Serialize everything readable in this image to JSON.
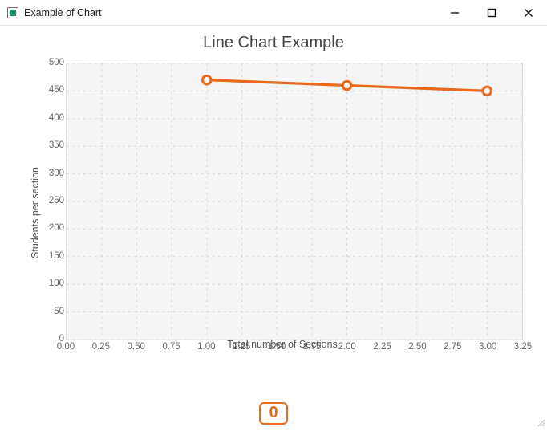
{
  "window": {
    "title": "Example of Chart",
    "min_label": "Minimize",
    "max_label": "Maximize",
    "close_label": "Close"
  },
  "chart_data": {
    "type": "line",
    "title": "Line Chart Example",
    "xlabel": "Total number of Sections",
    "ylabel": "Students per section",
    "x": [
      1.0,
      2.0,
      3.0
    ],
    "values": [
      470,
      460,
      450
    ],
    "xlim": [
      0.0,
      3.25
    ],
    "ylim": [
      0,
      500
    ],
    "x_ticks": [
      0.0,
      0.25,
      0.5,
      0.75,
      1.0,
      1.25,
      1.5,
      1.75,
      2.0,
      2.25,
      2.5,
      2.75,
      3.0,
      3.25
    ],
    "y_ticks": [
      0,
      50,
      100,
      150,
      200,
      250,
      300,
      350,
      400,
      450,
      500
    ],
    "series_name": "0",
    "series_color": "#e86a1e"
  },
  "badge": {
    "label": "0"
  }
}
